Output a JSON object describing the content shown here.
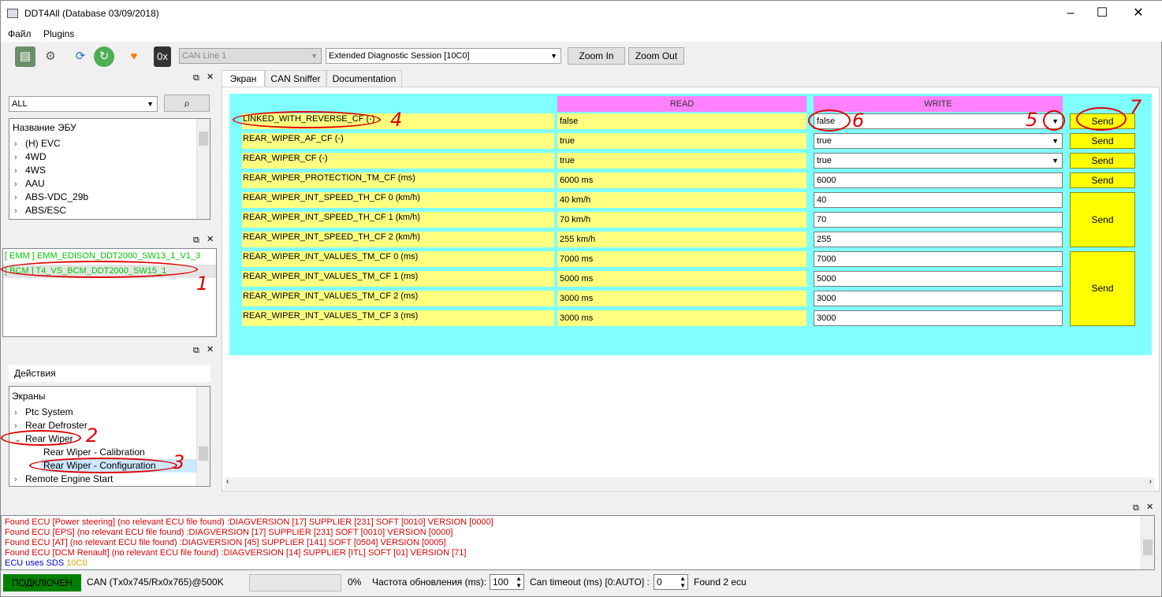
{
  "window": {
    "title": "DDT4All (Database 03/09/2018)",
    "minimize": "–",
    "maximize": "☐",
    "close": "✕"
  },
  "menu": {
    "file": "Файл",
    "plugins": "Plugins"
  },
  "toolbar": {
    "hex_label": "0x",
    "can_line": "CAN Line 1",
    "session": "Extended Diagnostic Session [10C0]",
    "zoom_in": "Zoom In",
    "zoom_out": "Zoom Out"
  },
  "ecu_panel": {
    "filter": "ALL",
    "header": "Название ЭБУ",
    "items": [
      "(H) EVC",
      "4WD",
      "4WS",
      "AAU",
      "ABS-VDC_29b",
      "ABS/ESC"
    ]
  },
  "found_panel": {
    "items": [
      "[ EMM ] EMM_EDISON_DDT2000_SW13_1_V1_3",
      "[ BCM ] T4_VS_BCM_DDT2000_SW15_1"
    ]
  },
  "actions_panel": {
    "header": "Действия",
    "root": "Экраны",
    "items": [
      "Ptc System",
      "Rear Defroster",
      "Rear Wiper",
      "Rear Wiper - Calibration",
      "Rear Wiper - Configuration",
      "Remote Engine Start"
    ]
  },
  "tabs": [
    "Экран",
    "CAN Sniffer",
    "Documentation"
  ],
  "screen": {
    "read_header": "READ",
    "write_header": "WRITE",
    "send": "Send",
    "rows": [
      {
        "label": "LINKED_WITH_REVERSE_CF (-)",
        "read": "false",
        "write": "false"
      },
      {
        "label": "REAR_WIPER_AF_CF (-)",
        "read": "true",
        "write": "true"
      },
      {
        "label": "REAR_WIPER_CF (-)",
        "read": "true",
        "write": "true"
      },
      {
        "label": "REAR_WIPER_PROTECTION_TM_CF (ms)",
        "read": "6000 ms",
        "write": "6000"
      },
      {
        "label": "REAR_WIPER_INT_SPEED_TH_CF 0 (km/h)",
        "read": "40 km/h",
        "write": "40"
      },
      {
        "label": "REAR_WIPER_INT_SPEED_TH_CF 1 (km/h)",
        "read": "70 km/h",
        "write": "70"
      },
      {
        "label": "REAR_WIPER_INT_SPEED_TH_CF 2 (km/h)",
        "read": "255 km/h",
        "write": "255"
      },
      {
        "label": "REAR_WIPER_INT_VALUES_TM_CF 0 (ms)",
        "read": "7000 ms",
        "write": "7000"
      },
      {
        "label": "REAR_WIPER_INT_VALUES_TM_CF 1 (ms)",
        "read": "5000 ms",
        "write": "5000"
      },
      {
        "label": "REAR_WIPER_INT_VALUES_TM_CF 2 (ms)",
        "read": "3000 ms",
        "write": "3000"
      },
      {
        "label": "REAR_WIPER_INT_VALUES_TM_CF 3 (ms)",
        "read": "3000 ms",
        "write": "3000"
      }
    ]
  },
  "log": {
    "lines": [
      "Found ECU [Power steering] (no relevant ECU file found) :DIAGVERSION [17] SUPPLIER [231] SOFT [0010] VERSION [0000]",
      "Found ECU [EPS] (no relevant ECU file found) :DIAGVERSION [17] SUPPLIER [231] SOFT [0010] VERSION [0000]",
      "Found ECU [AT] (no relevant ECU file found) :DIAGVERSION [45] SUPPLIER [141] SOFT [0504] VERSION [0005]",
      "Found ECU [DCM Renault] (no relevant ECU file found) :DIAGVERSION [14] SUPPLIER [ITL] SOFT [01] VERSION [71]"
    ],
    "sds_prefix": "ECU uses SDS",
    "sds_value": "10C0"
  },
  "status": {
    "connected": "ПОДКЛЮЧЕН",
    "can": "CAN (Tx0x745/Rx0x765)@500K",
    "progress": 0,
    "progress_text": "0%",
    "refresh_label": "Частота обновления (ms):",
    "refresh_value": "100",
    "timeout_label": "Can timeout (ms) [0:AUTO] :",
    "timeout_value": "0",
    "found": "Found 2 ecu"
  },
  "annotations": [
    "1",
    "2",
    "3",
    "4",
    "5",
    "6",
    "7"
  ],
  "colors": {
    "read_header": "#ff80ff",
    "label_bg": "#ffff80",
    "screen_bg": "#80ffff",
    "send_bg": "#ffff00",
    "connected_bg": "#008000"
  }
}
